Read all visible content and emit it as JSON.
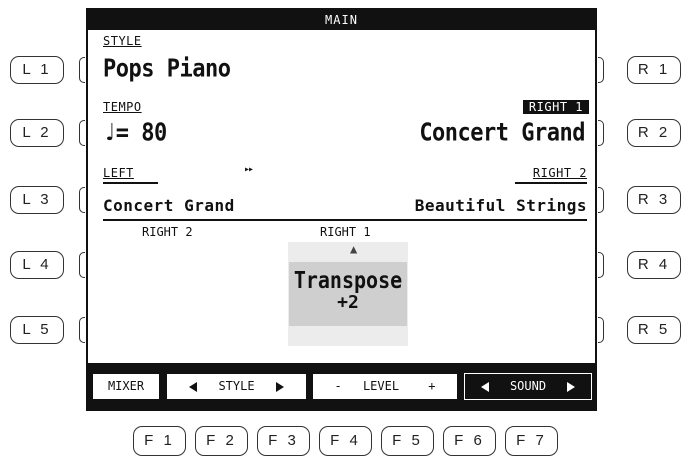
{
  "left_buttons": [
    "L 1",
    "L 2",
    "L 3",
    "L 4",
    "L 5"
  ],
  "right_buttons": [
    "R 1",
    "R 2",
    "R 3",
    "R 4",
    "R 5"
  ],
  "function_buttons": [
    "F 1",
    "F 2",
    "F 3",
    "F 4",
    "F 5",
    "F 6",
    "F 7"
  ],
  "screen": {
    "title": "MAIN",
    "style": {
      "label": "STYLE",
      "value": "Pops Piano"
    },
    "tempo": {
      "label": "TEMPO",
      "note_symbol": "♩",
      "value": "= 80"
    },
    "right1": {
      "label": "RIGHT 1",
      "value": "Concert Grand"
    },
    "left": {
      "label": "LEFT",
      "value": "Concert Grand",
      "indicator": "▸▸"
    },
    "right2": {
      "label": "RIGHT 2",
      "value": "Beautiful Strings"
    },
    "keyboard_labels": {
      "right2": "RIGHT 2",
      "right1": "RIGHT 1"
    },
    "popup": {
      "line1": "Transpose",
      "line2": "+2"
    },
    "softkeys": {
      "mixer": "MIXER",
      "style": "STYLE",
      "level_minus": "-",
      "level": "LEVEL",
      "level_plus": "+",
      "sound": "SOUND"
    }
  }
}
